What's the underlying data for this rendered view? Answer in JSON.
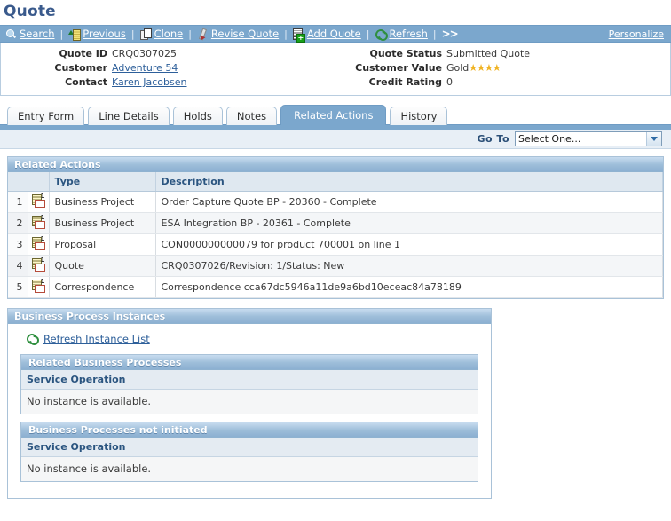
{
  "page": {
    "title": "Quote"
  },
  "toolbar": {
    "items": [
      {
        "label": "Search",
        "icon": "magnifier-icon",
        "accesskey": "S"
      },
      {
        "label": "Previous",
        "icon": "previous-icon",
        "accesskey": "P"
      },
      {
        "label": "Clone",
        "icon": "clone-icon",
        "accesskey": "C"
      },
      {
        "label": "Revise Quote",
        "icon": "pencil-icon",
        "accesskey": "R"
      },
      {
        "label": "Add Quote",
        "icon": "add-document-icon",
        "accesskey": "A"
      },
      {
        "label": "Refresh",
        "icon": "refresh-icon",
        "accesskey": "R"
      }
    ],
    "separator": "|",
    "more_label": ">>",
    "personalize_label": "Personalize"
  },
  "header": {
    "left": [
      {
        "label": "Quote ID",
        "value": "CRQ0307025",
        "is_link": false
      },
      {
        "label": "Customer",
        "value": "Adventure 54",
        "is_link": true
      },
      {
        "label": "Contact",
        "value": "Karen Jacobsen",
        "is_link": true
      }
    ],
    "right": [
      {
        "label": "Quote Status",
        "value": "Submitted Quote",
        "stars": 0
      },
      {
        "label": "Customer Value",
        "value": "Gold",
        "stars": 4
      },
      {
        "label": "Credit Rating",
        "value": "0",
        "stars": 0
      }
    ],
    "star_glyph": "★",
    "star_color": "#f0b323"
  },
  "tabs": [
    {
      "label": "Entry Form",
      "active": false
    },
    {
      "label": "Line Details",
      "active": false
    },
    {
      "label": "Holds",
      "active": false
    },
    {
      "label": "Notes",
      "active": false
    },
    {
      "label": "Related Actions",
      "active": true
    },
    {
      "label": "History",
      "active": false
    }
  ],
  "goto": {
    "label": "Go To",
    "selected": "Select One...",
    "options": [
      "Select One..."
    ]
  },
  "related_actions": {
    "panel_title": "Related Actions",
    "columns": [
      "",
      "",
      "Type",
      "Description"
    ],
    "rows": [
      {
        "num": "1",
        "icon": "document-detail-icon",
        "type": "Business Project",
        "description": "Order Capture Quote BP - 20360 - Complete"
      },
      {
        "num": "2",
        "icon": "document-detail-icon",
        "type": "Business Project",
        "description": "ESA Integration BP - 20361 - Complete"
      },
      {
        "num": "3",
        "icon": "document-detail-icon",
        "type": "Proposal",
        "description": "CON000000000079 for product 700001 on line 1"
      },
      {
        "num": "4",
        "icon": "document-detail-icon",
        "type": "Quote",
        "description": "CRQ0307026/Revision: 1/Status: New"
      },
      {
        "num": "5",
        "icon": "document-detail-icon",
        "type": "Correspondence",
        "description": "Correspondence cca67dc5946a11de9a6bd10eceac84a78189"
      }
    ]
  },
  "bpi": {
    "panel_title": "Business Process Instances",
    "refresh_link": "Refresh Instance List",
    "refresh_icon": "refresh-icon",
    "sections": [
      {
        "title": "Related Business Processes",
        "column": "Service Operation",
        "empty_message": "No instance is available."
      },
      {
        "title": "Business Processes not initiated",
        "column": "Service Operation",
        "empty_message": "No instance is available."
      }
    ]
  },
  "colors": {
    "toolbar_blue": "#7ba7cd",
    "title_blue": "#3a5a8c",
    "link_blue": "#2d5f9a",
    "panel_header_blue": "#9dbdd9",
    "star_gold": "#f0b323"
  }
}
